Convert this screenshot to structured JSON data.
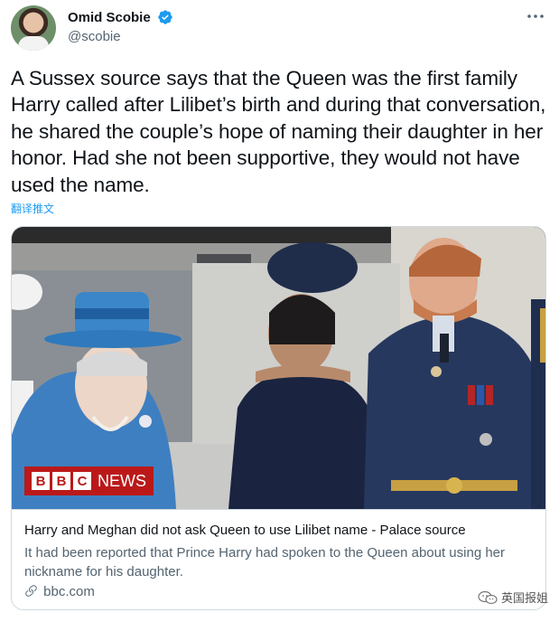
{
  "author": {
    "name": "Omid Scobie",
    "handle": "@scobie",
    "verified": true
  },
  "icons": {
    "avatar": "avatar",
    "verified": "verified-badge-icon",
    "more": "more-options-icon",
    "link": "link-icon",
    "watermark": "wechat-icon"
  },
  "tweet": {
    "text": "A Sussex source says that the Queen was the first family Harry called after Lilibet’s birth and during that conversation, he shared the couple’s hope of naming their daughter in her honor. Had she not been supportive, they would not have used the name.",
    "translate_label": "翻译推文"
  },
  "card": {
    "title": "Harry and Meghan did not ask Queen to use Lilibet name - Palace source",
    "description": "It had been reported that Prince Harry had spoken to the Queen about using her nickname for his daughter.",
    "domain": "bbc.com",
    "logo": {
      "letters": [
        "B",
        "B",
        "C"
      ],
      "news": "NEWS"
    }
  },
  "watermark": "英国报姐",
  "colors": {
    "link_blue": "#1d9bf0",
    "bbc_red": "#bb1919",
    "secondary_text": "#536471",
    "border": "#cfd9de"
  }
}
